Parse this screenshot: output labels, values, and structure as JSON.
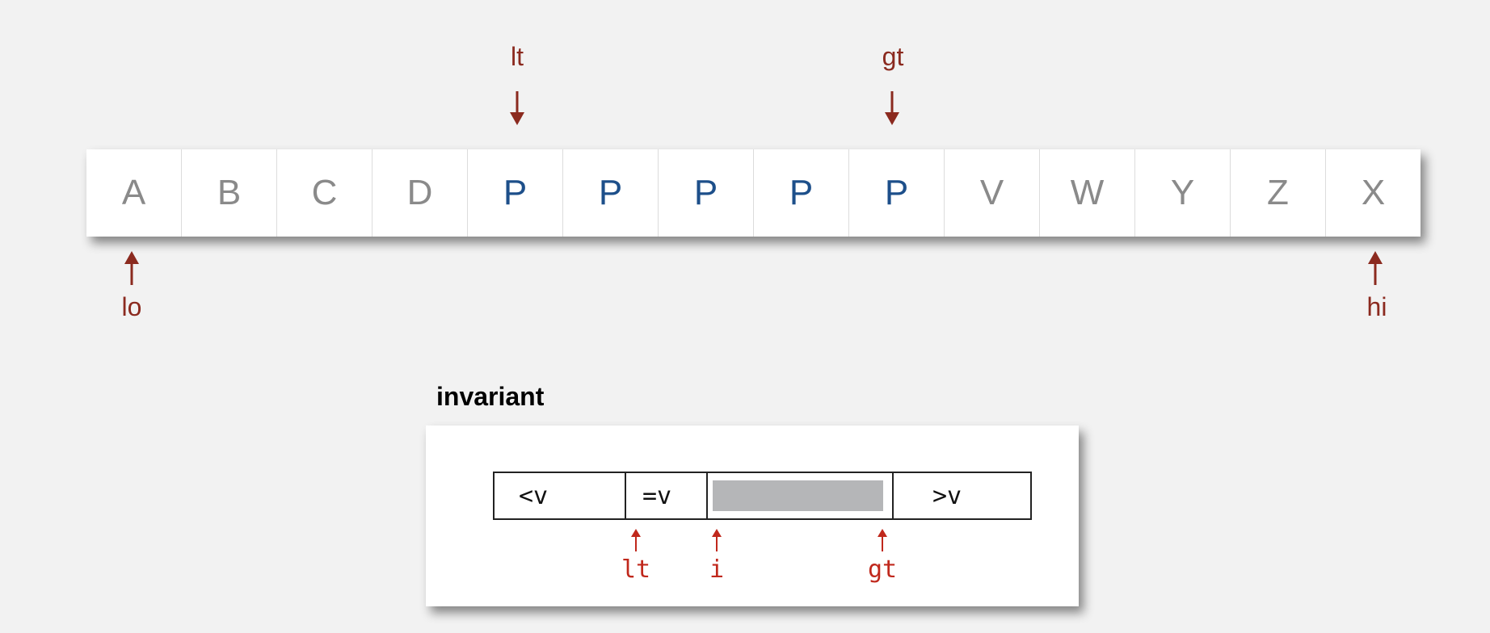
{
  "array": {
    "cells": [
      "A",
      "B",
      "C",
      "D",
      "P",
      "P",
      "P",
      "P",
      "P",
      "V",
      "W",
      "Y",
      "Z",
      "X"
    ],
    "equal_value": "P"
  },
  "pointers": {
    "lt": "lt",
    "gt": "gt",
    "lo": "lo",
    "hi": "hi"
  },
  "invariant": {
    "title": "invariant",
    "segments": {
      "less": "<v",
      "equal": "=v",
      "greater": ">v"
    },
    "labels": {
      "lt": "lt",
      "i": "i",
      "gt": "gt"
    }
  },
  "colors": {
    "pointer": "#8b2a1f",
    "invariant_pointer": "#c0281c",
    "equal_key": "#1d4f8a",
    "other_key": "#8a8a8a",
    "unknown_region": "#b5b6b8"
  }
}
